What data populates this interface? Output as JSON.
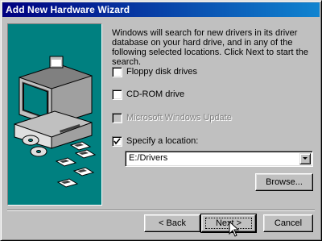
{
  "window": {
    "title": "Add New Hardware Wizard"
  },
  "intro": {
    "text": "Windows will search for new drivers in its driver database on your hard drive, and in any of the following selected locations. Click Next to start the search."
  },
  "options": [
    {
      "label": "Floppy disk drives",
      "checked": false,
      "enabled": true
    },
    {
      "label": "CD-ROM drive",
      "checked": false,
      "enabled": true
    },
    {
      "label": "Microsoft Windows Update",
      "checked": false,
      "enabled": false
    },
    {
      "label": "Specify a location:",
      "checked": true,
      "enabled": true
    }
  ],
  "location": {
    "value": "E:/Drivers"
  },
  "buttons": {
    "browse": "Browse...",
    "back": "< Back",
    "next": "Next >",
    "cancel": "Cancel"
  },
  "colors": {
    "title_gradient_start": "#000080",
    "title_gradient_end": "#1084d0",
    "illustration_bg": "#008080",
    "face": "#c0c0c0"
  }
}
